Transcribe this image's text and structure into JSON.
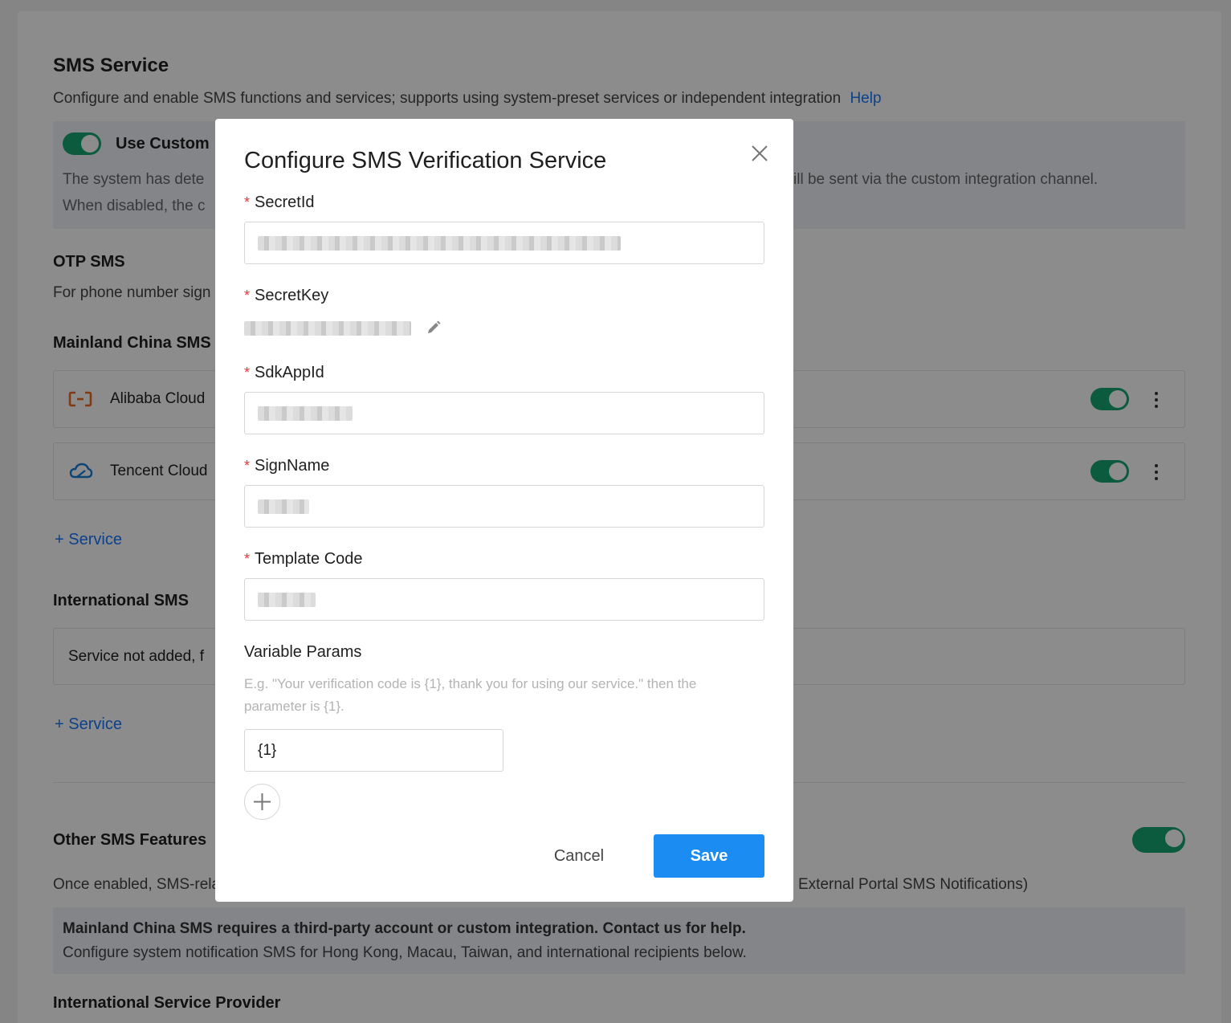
{
  "background": {
    "title": "SMS Service",
    "description": "Configure and enable SMS functions and services; supports using system-preset services or independent integration",
    "help_link": "Help",
    "custom_toggle_label": "Use Custom",
    "custom_info_line1_left": "The system has dete",
    "custom_info_line1_right": "ill be sent via the custom integration channel.",
    "custom_info_line2_left": "When disabled, the c",
    "otp_title": "OTP SMS",
    "otp_desc": "For phone number sign",
    "mainland_title": "Mainland China SMS",
    "providers": [
      {
        "name": "Alibaba Cloud",
        "enabled": true
      },
      {
        "name": "Tencent Cloud",
        "enabled": true
      }
    ],
    "add_service_1": "Service",
    "international_title": "International SMS",
    "international_empty": "Service not added, f",
    "add_service_2": "Service",
    "other_title": "Other SMS Features",
    "other_desc_left": "Once enabled, SMS-rela",
    "other_desc_right": "External Portal SMS Notifications)",
    "notice_bold": "Mainland China SMS requires a third-party account or custom integration. Contact us for help.",
    "notice_text": "Configure system notification SMS for Hong Kong, Macau, Taiwan, and international recipients below.",
    "intl_provider_title": "International Service Provider"
  },
  "modal": {
    "title": "Configure SMS Verification Service",
    "fields": {
      "secret_id": {
        "label": "SecretId",
        "required": true
      },
      "secret_key": {
        "label": "SecretKey",
        "required": true
      },
      "sdk_app_id": {
        "label": "SdkAppId",
        "required": true
      },
      "sign_name": {
        "label": "SignName",
        "required": true
      },
      "template_code": {
        "label": "Template Code",
        "required": true
      }
    },
    "variable_params_label": "Variable Params",
    "variable_params_hint": "E.g. \"Your verification code is {1}, thank you for using our service.\" then the parameter is {1}.",
    "variable_params_value": "{1}",
    "cancel_label": "Cancel",
    "save_label": "Save"
  },
  "colors": {
    "accent": "#1677ff",
    "toggle_on": "#17a673",
    "required": "#e4393c",
    "save_button": "#1b8cf2"
  },
  "icons": [
    "alibaba-cloud-icon",
    "tencent-cloud-icon",
    "edit-pencil-icon",
    "close-icon",
    "plus-icon",
    "kebab-menu-icon"
  ]
}
